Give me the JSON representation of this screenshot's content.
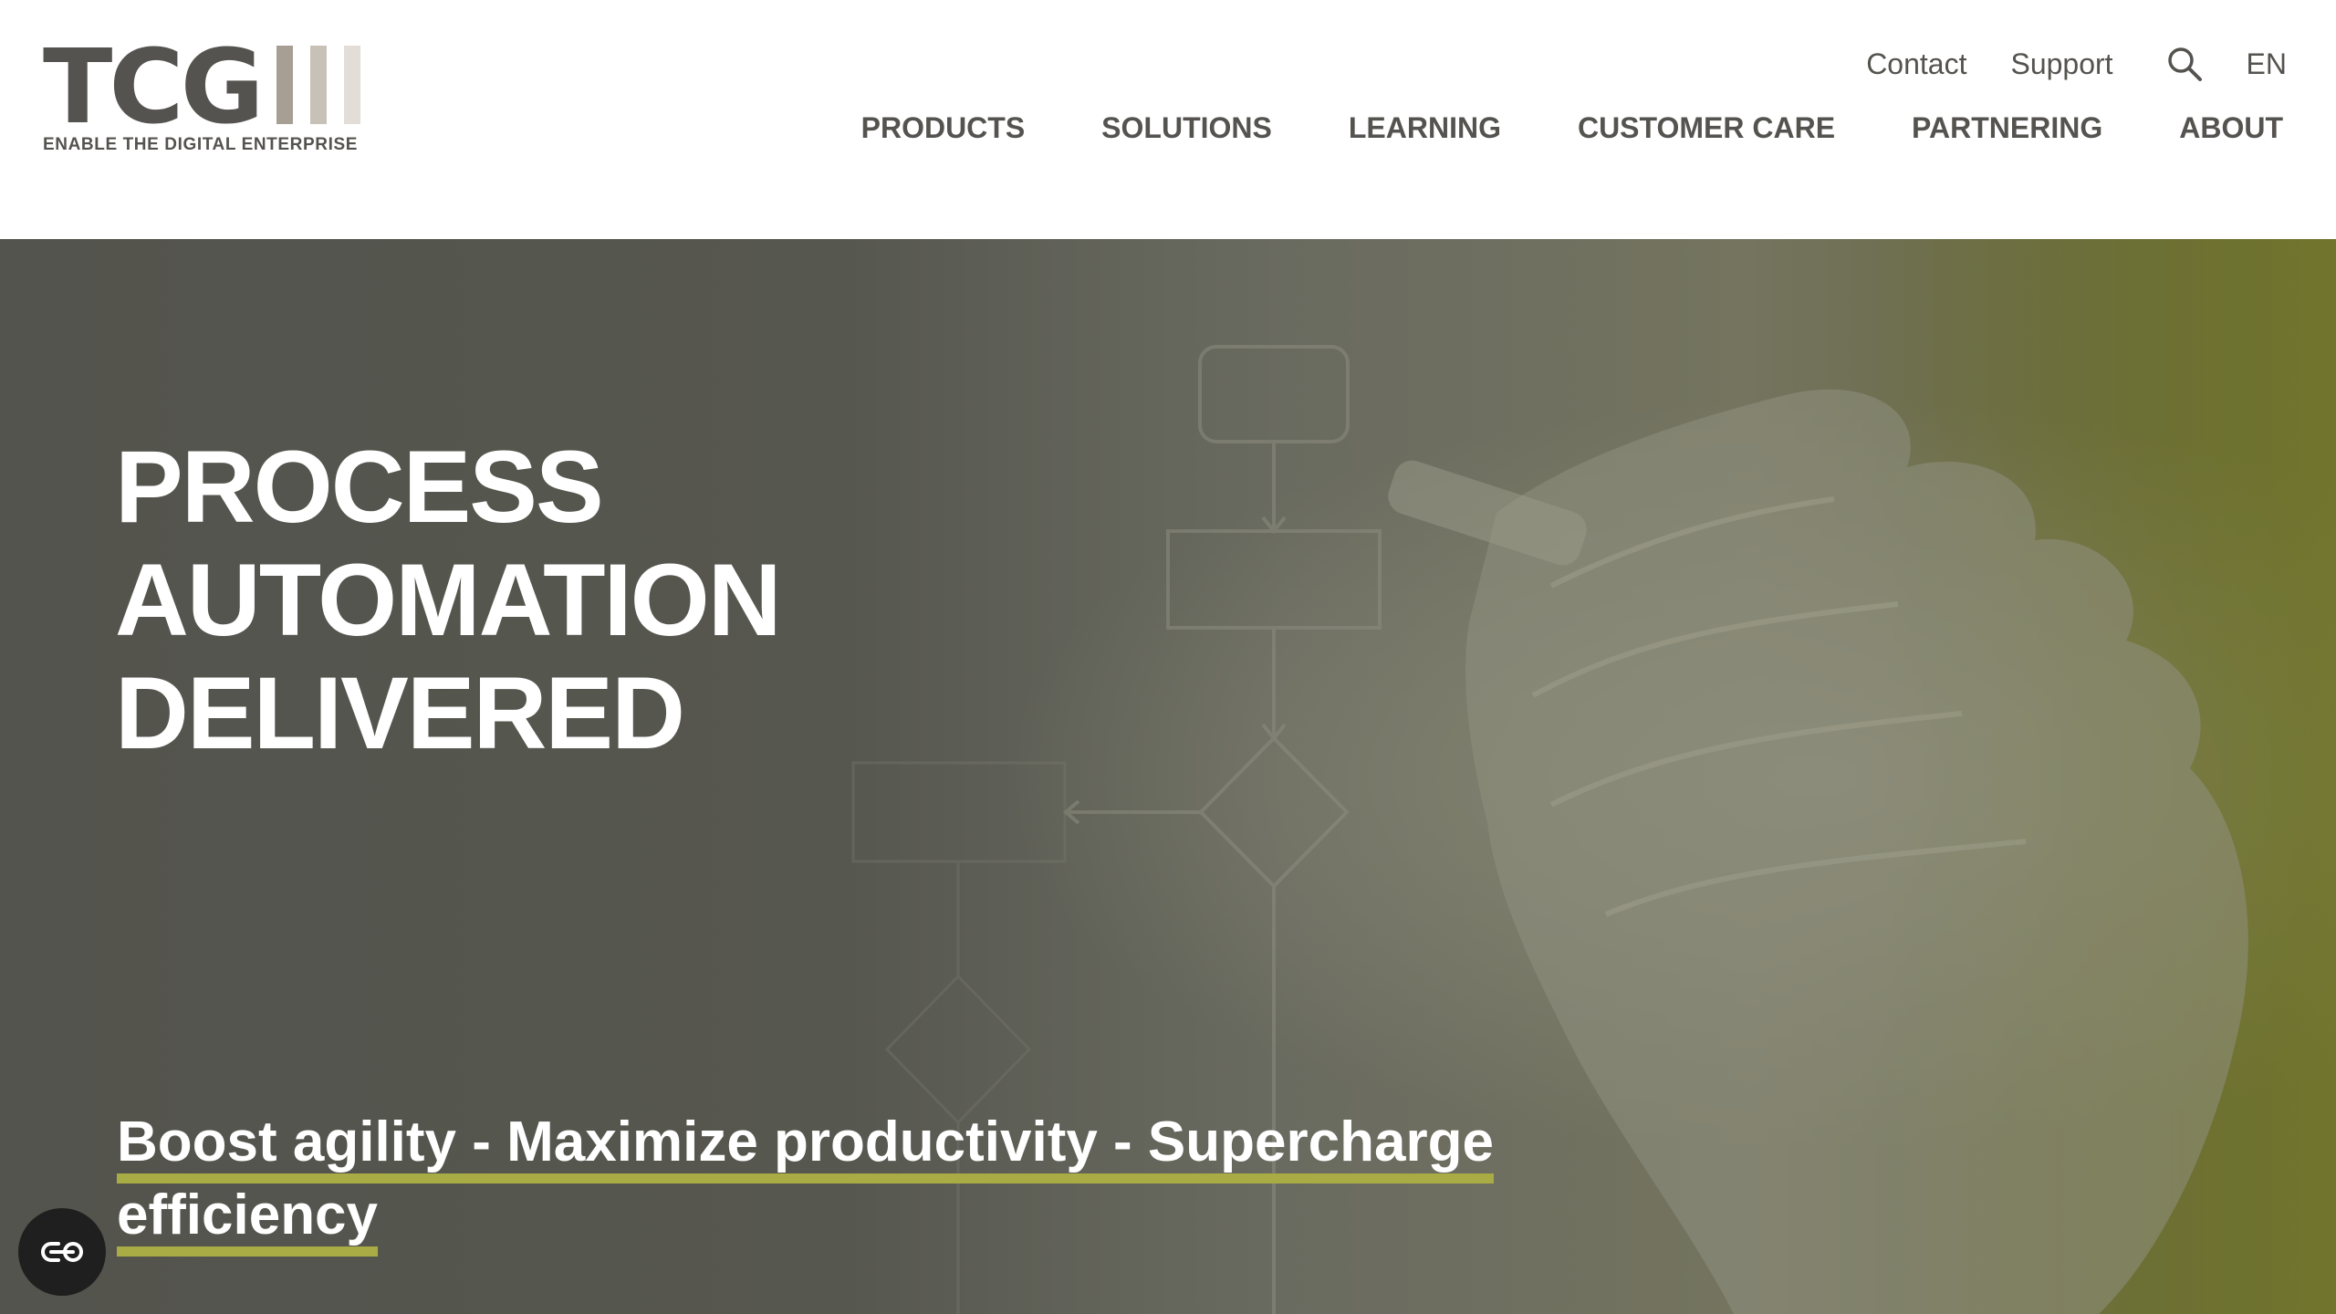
{
  "logo": {
    "letters": "TCG",
    "tagline": "ENABLE THE DIGITAL ENTERPRISE",
    "bar_colors": [
      "#a79f94",
      "#c7c1b8",
      "#e2ded7"
    ]
  },
  "utility_nav": {
    "contact": "Contact",
    "support": "Support",
    "search_icon": "search-icon",
    "language": "EN"
  },
  "main_nav": {
    "items": [
      {
        "label": "PRODUCTS"
      },
      {
        "label": "SOLUTIONS"
      },
      {
        "label": "LEARNING"
      },
      {
        "label": "CUSTOMER CARE"
      },
      {
        "label": "PARTNERING"
      },
      {
        "label": "ABOUT"
      }
    ]
  },
  "hero": {
    "title_lines": [
      "PROCESS",
      "AUTOMATION",
      "DELIVERED"
    ],
    "tagline": "Boost agility - Maximize productivity - Supercharge efficiency",
    "background_color": "#53544d",
    "accent_color": "#a9ac44"
  },
  "accessibility_button": {
    "icon": "accessibility-toggle-icon"
  },
  "colors": {
    "text_dark": "#55534f",
    "header_bg": "#ffffff",
    "accent": "#a9ac44"
  }
}
